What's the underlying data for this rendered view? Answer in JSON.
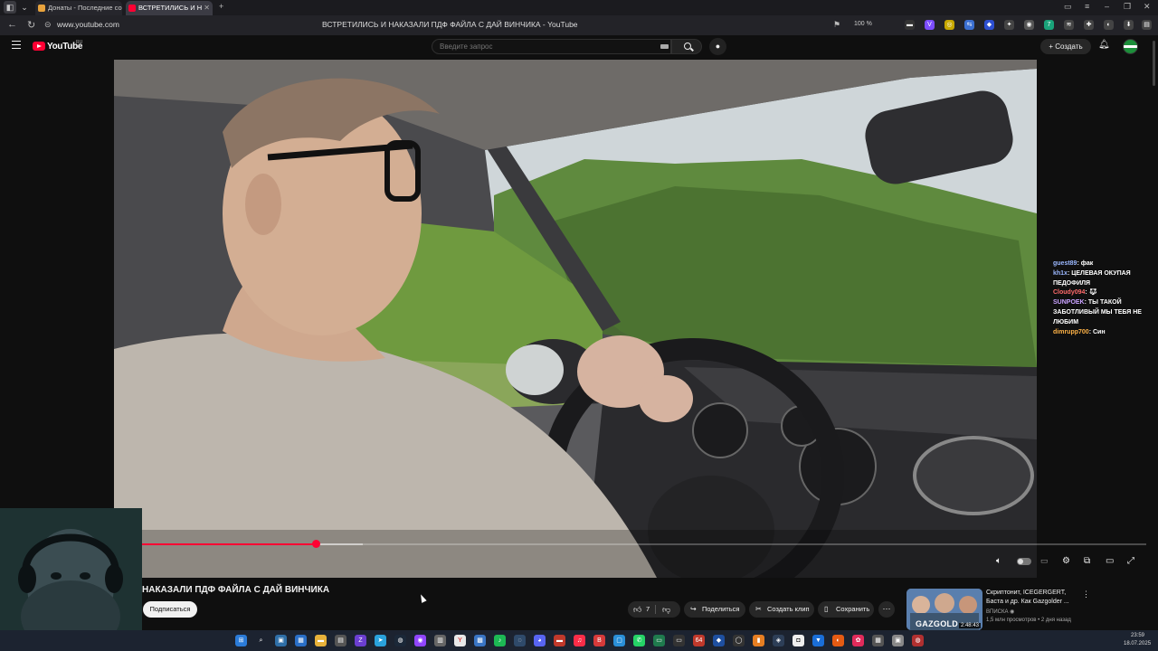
{
  "browser": {
    "tabs": [
      {
        "label": "Донаты - Последние сос",
        "favicon_color": "#e8a33d",
        "active": false
      },
      {
        "label": "ВСТРЕТИЛИСЬ И Н",
        "favicon_color": "#ff0033",
        "active": true
      }
    ],
    "url": "www.youtube.com",
    "page_title": "ВСТРЕТИЛИСЬ И НАКАЗАЛИ ПДФ ФАЙЛА С ДАЙ ВИНЧИКА - YouTube",
    "zoom": "100 %"
  },
  "masthead": {
    "logo_text": "YouTube",
    "logo_country": "RU",
    "search_placeholder": "Введите запрос",
    "create_label": "Создать"
  },
  "player": {
    "progress_played_fraction": 0.174,
    "progress_buffered_fraction": 0.22
  },
  "chat": [
    {
      "user": "guest89",
      "text": "фак",
      "color": "#9bb8ff"
    },
    {
      "user": "kh1x",
      "text": "ЦЕЛЕВАЯ ОКУПАЯ ПЕДОФИЛЯ",
      "color": "#9bb8ff"
    },
    {
      "user": "Cloudy094",
      "text": "",
      "color": "#ff6b6b"
    },
    {
      "user": "SUNPOEK",
      "text": "ТЫ ТАКОЙ ЗАБОТЛИВЫЙ МЫ ТЕБЯ НЕ ЛЮБИМ",
      "color": "#c9a2ff"
    },
    {
      "user": "dimrupp700",
      "text": "Син",
      "color": "#ffb347"
    }
  ],
  "video": {
    "title": "НАКАЗАЛИ ПДФ ФАЙЛА С ДАЙ ВИНЧИКА",
    "subscribe_label": "Подписаться",
    "like_count": "7",
    "share_label": "Поделиться",
    "clip_label": "Создать клип",
    "save_label": "Сохранить"
  },
  "recommendation": {
    "title": "Скриптонит, ICEGERGERT, Баста и др. Как Gazgolder ...",
    "channel": "ВПИСКА",
    "meta": "1,5 млн просмотров • 2 дня назад",
    "duration": "2:48:43",
    "thumb_text": "GAZGOLD"
  },
  "taskbar": {
    "time": "23:59",
    "date": "18.07.2025",
    "counter_badge": "64"
  },
  "colors": {
    "accent_red": "#ff0033",
    "background": "#0f0f0f"
  }
}
